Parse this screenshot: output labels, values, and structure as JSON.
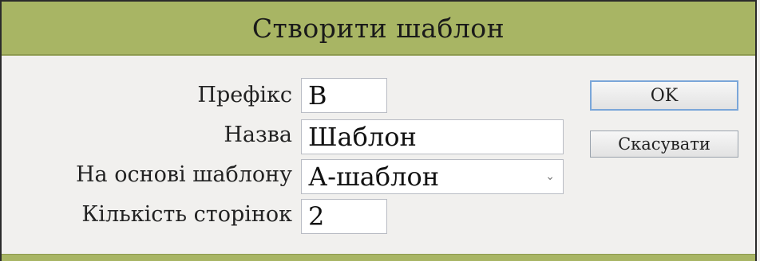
{
  "dialog": {
    "title": "Створити шаблон",
    "fields": {
      "prefix": {
        "label": "Префікс",
        "value": "B"
      },
      "name": {
        "label": "Назва",
        "value": "Шаблон"
      },
      "based_on": {
        "label": "На основі шаблону",
        "value": "А-шаблон"
      },
      "page_count": {
        "label": "Кількість сторінок",
        "value": "2"
      }
    },
    "buttons": {
      "ok": "OK",
      "cancel": "Скасувати"
    },
    "colors": {
      "titlebar": "#a8b564",
      "background": "#f1f0ee",
      "ok_border": "#7aa6d9"
    }
  }
}
